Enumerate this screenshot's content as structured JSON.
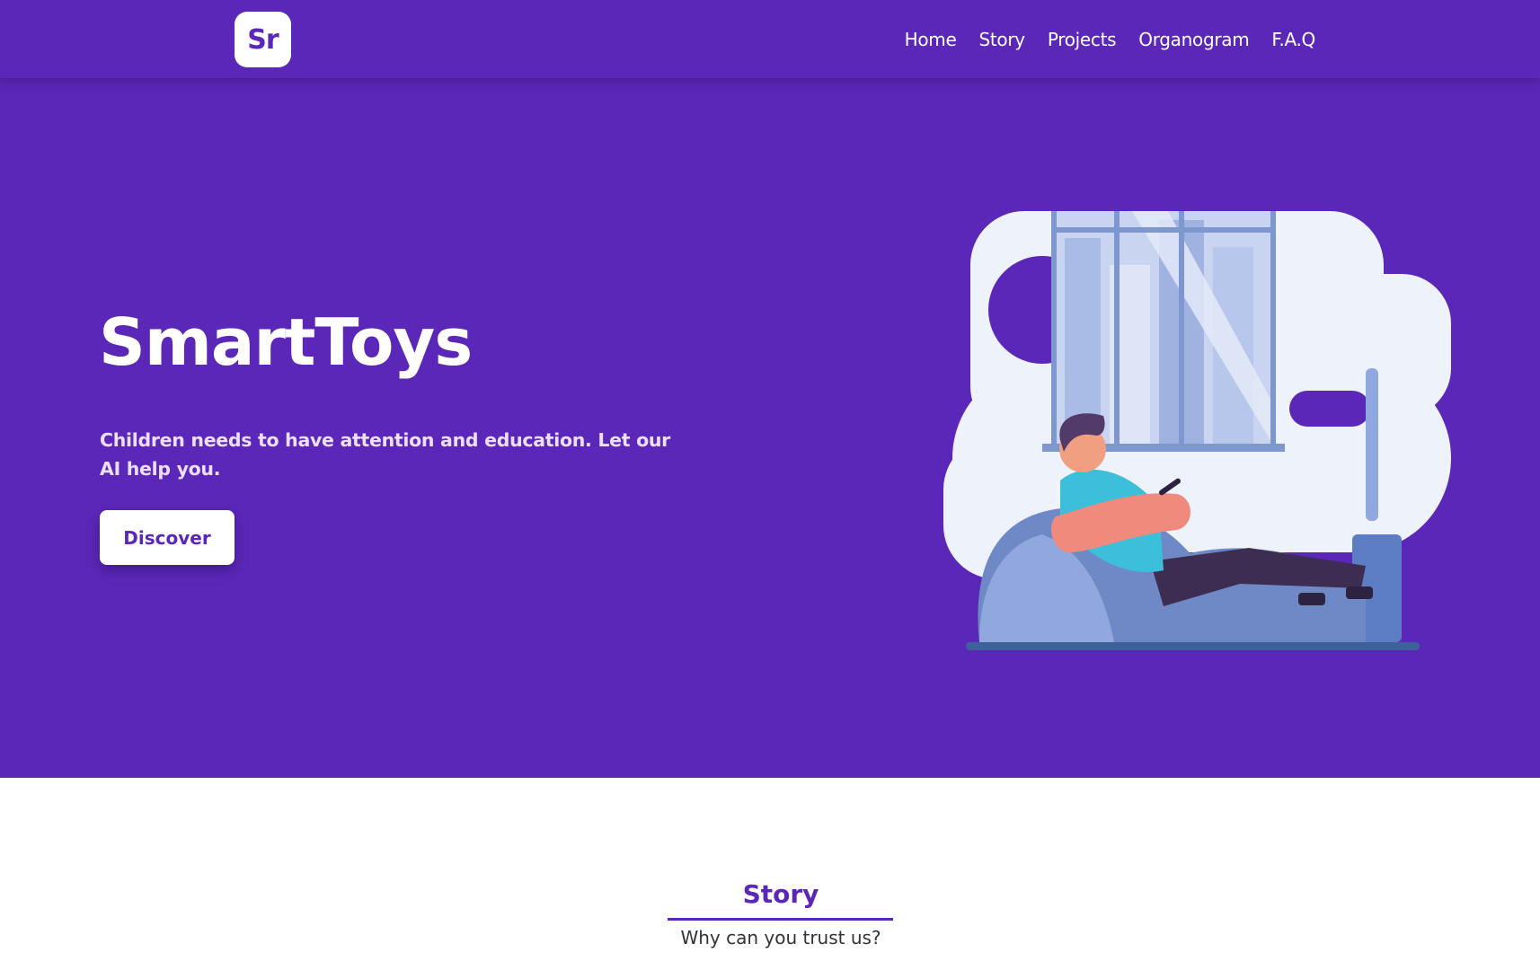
{
  "navbar": {
    "logo_text": "Sr",
    "links": [
      {
        "label": "Home"
      },
      {
        "label": "Story"
      },
      {
        "label": "Projects"
      },
      {
        "label": "Organogram"
      },
      {
        "label": "F.A.Q"
      }
    ]
  },
  "hero": {
    "title": "SmartToys",
    "description": "Children needs to have attention and education. Let our AI help you.",
    "cta_label": "Discover",
    "illustration_icon": "person-on-beanbag-with-phone-illustration"
  },
  "story": {
    "title": "Story",
    "subtitle": "Why can you trust us?"
  },
  "colors": {
    "brand_purple": "#5b27b8",
    "hero_text": "#ecdffb",
    "white": "#ffffff"
  }
}
